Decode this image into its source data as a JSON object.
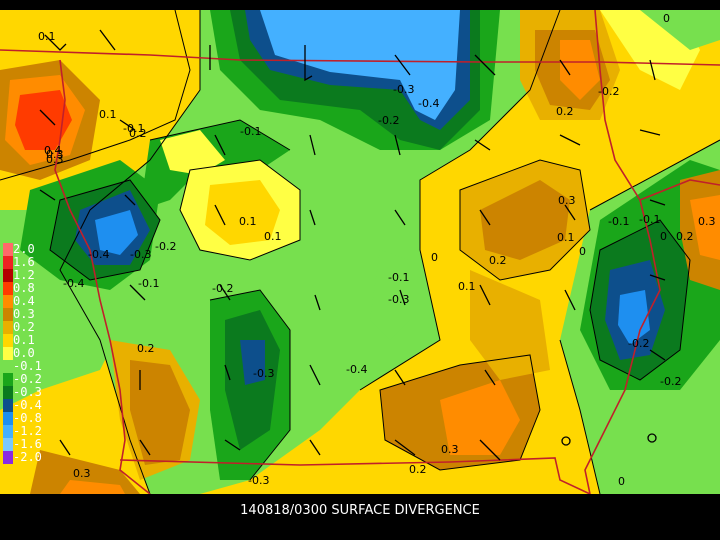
{
  "caption": "140818/0300 SURFACE DIVERGENCE",
  "legend": [
    {
      "label": "2.0",
      "color": "#ff6a6a"
    },
    {
      "label": "1.6",
      "color": "#ee2222"
    },
    {
      "label": "1.2",
      "color": "#b30000"
    },
    {
      "label": "0.8",
      "color": "#ff3b00"
    },
    {
      "label": "0.4",
      "color": "#ff8c00"
    },
    {
      "label": "0.3",
      "color": "#cc8400"
    },
    {
      "label": "0.2",
      "color": "#e8b000"
    },
    {
      "label": "0.1",
      "color": "#ffd700"
    },
    {
      "label": "0.0",
      "color": "#ffff44"
    },
    {
      "label": "-0.1",
      "color": "#77e04e"
    },
    {
      "label": "-0.2",
      "color": "#1aa61a"
    },
    {
      "label": "-0.3",
      "color": "#0b7a1e"
    },
    {
      "label": "-0.4",
      "color": "#0d4f8c"
    },
    {
      "label": "-0.8",
      "color": "#1e8ff0"
    },
    {
      "label": "-1.2",
      "color": "#44b0ff"
    },
    {
      "label": "-1.6",
      "color": "#7ac8ff"
    },
    {
      "label": "-2.0",
      "color": "#8a2be2"
    }
  ],
  "contour_labels": [
    "0.1",
    "0.1",
    "-0.1",
    "0.4",
    "0.3",
    "-0.1",
    "-0.3",
    "-0.4",
    "-0.2",
    "0.2",
    "-0.2",
    "0.3",
    "0.2",
    "0.1",
    "-0.4",
    "-0.3",
    "-0.4",
    "-0.2",
    "0.1",
    "-0.1",
    "0",
    "0",
    "0.1",
    "0.2",
    "0.3",
    "0.1",
    "0",
    "-0.1",
    "0.2",
    "0.3",
    "-0.1",
    "-0.2",
    "-0.1",
    "-0.2",
    "0.2",
    "-0.3",
    "0.3",
    "0.2",
    "0.3",
    "-0.3",
    "0",
    "-0.4",
    "-0.3",
    "-0.2",
    "0"
  ]
}
